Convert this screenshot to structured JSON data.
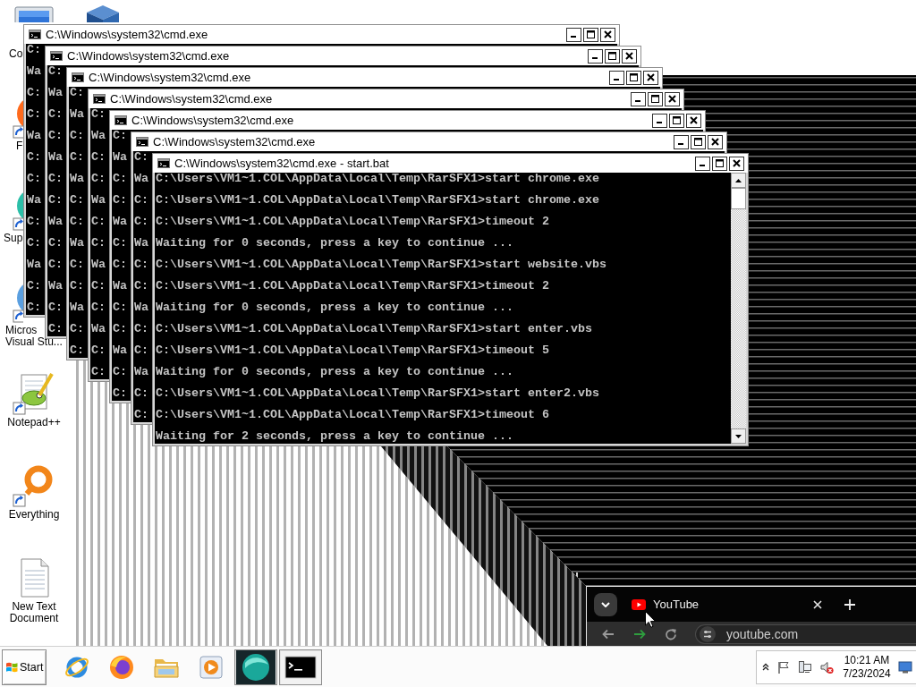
{
  "desktop": {
    "icons": [
      {
        "kind": "computer",
        "label_lines": [
          "Co"
        ]
      },
      {
        "kind": "browser",
        "label_lines": [
          "F"
        ]
      },
      {
        "kind": "app",
        "label_lines": [
          "Sup"
        ]
      },
      {
        "kind": "ide",
        "label_lines": [
          "Micros",
          "Visual Stu..."
        ]
      },
      {
        "kind": "editor",
        "label_lines": [
          "Notepad++"
        ]
      },
      {
        "kind": "search",
        "label_lines": [
          "Everything"
        ]
      },
      {
        "kind": "document",
        "label_lines": [
          "New Text",
          "Document"
        ]
      },
      {
        "kind": "package"
      }
    ]
  },
  "windows": [
    {
      "title": "C:\\Windows\\system32\\cmd.exe",
      "lines": [
        "C:",
        "Wa",
        "C:",
        "C:",
        "Wa",
        "C:",
        "C:",
        "Wa",
        "C:",
        "C:",
        "Wa",
        "C:",
        "C:"
      ]
    },
    {
      "title": "C:\\Windows\\system32\\cmd.exe",
      "lines": [
        "C:",
        "Wa",
        "C:",
        "C:",
        "Wa",
        "C:",
        "C:",
        "Wa",
        "C:",
        "C:",
        "Wa",
        "C:",
        "C:"
      ]
    },
    {
      "title": "C:\\Windows\\system32\\cmd.exe",
      "lines": [
        "C:",
        "Wa",
        "C:",
        "C:",
        "Wa",
        "C:",
        "C:",
        "Wa",
        "C:",
        "C:",
        "Wa",
        "C:",
        "C:"
      ]
    },
    {
      "title": "C:\\Windows\\system32\\cmd.exe",
      "lines": [
        "C:",
        "Wa",
        "C:",
        "C:",
        "Wa",
        "C:",
        "C:",
        "Wa",
        "C:",
        "C:",
        "Wa",
        "C:",
        "C:"
      ]
    },
    {
      "title": "C:\\Windows\\system32\\cmd.exe",
      "lines": [
        "C:",
        "Wa",
        "C:",
        "C:",
        "Wa",
        "C:",
        "C:",
        "Wa",
        "C:",
        "C:",
        "Wa",
        "C:",
        "C:"
      ]
    },
    {
      "title": "C:\\Windows\\system32\\cmd.exe",
      "lines": [
        "C:",
        "Wa",
        "C:",
        "C:",
        "Wa",
        "C:",
        "C:",
        "Wa",
        "C:",
        "C:",
        "Wa",
        "C:",
        "C:"
      ]
    },
    {
      "title": "C:\\Windows\\system32\\cmd.exe - start.bat",
      "lines": [
        "C:\\Users\\VM1~1.COL\\AppData\\Local\\Temp\\RarSFX1>start chrome.exe",
        "C:\\Users\\VM1~1.COL\\AppData\\Local\\Temp\\RarSFX1>start chrome.exe",
        "C:\\Users\\VM1~1.COL\\AppData\\Local\\Temp\\RarSFX1>timeout 2",
        "Waiting for 0 seconds, press a key to continue ...",
        "C:\\Users\\VM1~1.COL\\AppData\\Local\\Temp\\RarSFX1>start website.vbs",
        "C:\\Users\\VM1~1.COL\\AppData\\Local\\Temp\\RarSFX1>timeout 2",
        "Waiting for 0 seconds, press a key to continue ...",
        "C:\\Users\\VM1~1.COL\\AppData\\Local\\Temp\\RarSFX1>start enter.vbs",
        "C:\\Users\\VM1~1.COL\\AppData\\Local\\Temp\\RarSFX1>timeout 5",
        "Waiting for 0 seconds, press a key to continue ...",
        "C:\\Users\\VM1~1.COL\\AppData\\Local\\Temp\\RarSFX1>start enter2.vbs",
        "C:\\Users\\VM1~1.COL\\AppData\\Local\\Temp\\RarSFX1>timeout 6",
        "Waiting for 2 seconds, press a key to continue ..."
      ]
    }
  ],
  "browser": {
    "tabs": [
      {
        "title": "YouTube"
      }
    ],
    "address": "youtube.com"
  },
  "taskbar": {
    "start_label": "Start",
    "items": [
      {
        "kind": "ie",
        "active": false
      },
      {
        "kind": "firefox",
        "active": false
      },
      {
        "kind": "explorer",
        "active": false
      },
      {
        "kind": "media",
        "active": false
      },
      {
        "kind": "sphere",
        "active": true
      },
      {
        "kind": "console",
        "active": true
      }
    ],
    "clock": {
      "time": "10:21 AM",
      "date": "7/23/2024"
    }
  }
}
